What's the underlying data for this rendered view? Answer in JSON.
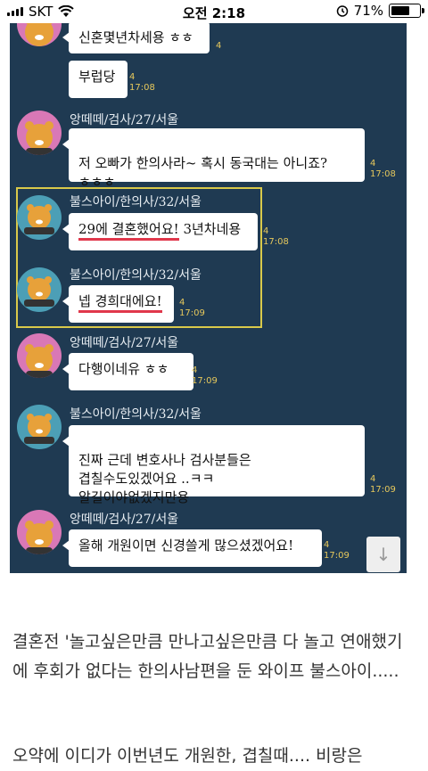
{
  "statusbar": {
    "carrier": "SKT",
    "time": "오전 2:18",
    "battery_text": "71%",
    "battery_level_pct": 71,
    "icons": [
      "signal-icon",
      "wifi-icon",
      "alarm-icon",
      "battery-icon"
    ]
  },
  "chat": {
    "background": "#1f3a52",
    "messages": [
      {
        "text": "신혼몇년차세용 ㅎㅎ",
        "unread": "4",
        "time": ""
      },
      {
        "text": "부럽당",
        "unread": "4",
        "time": "17:08"
      },
      {
        "sender": "앙떼떼/검사/27/서울",
        "text": "저 오빠가 한의사라~ 혹시 동국대는 아니죠?\nㅎㅎㅎ",
        "unread": "4",
        "time": "17:08"
      },
      {
        "sender": "불스아이/한의사/32/서울",
        "text_highlight": "29에 결혼했어요!",
        "text_rest": " 3년차네용",
        "unread": "4",
        "time": "17:08"
      },
      {
        "sender": "불스아이/한의사/32/서울",
        "text_highlight": "넵 경희대에요!",
        "unread": "4",
        "time": "17:09"
      },
      {
        "sender": "앙떼떼/검사/27/서울",
        "text": "다행이네유 ㅎㅎ",
        "unread": "4",
        "time": "17:09"
      },
      {
        "sender": "불스아이/한의사/32/서울",
        "text": "진짜 근데 변호사나 검사분들은\n겹칠수도있겠어요 ..ㅋㅋ\n알길이야없겠지만용",
        "unread": "4",
        "time": "17:09"
      },
      {
        "sender": "앙떼떼/검사/27/서울",
        "text": "올해 개원이면 신경쓸게 많으셨겠어요!",
        "unread": "4",
        "time": "17:09"
      }
    ],
    "scroll_button": "↓"
  },
  "article": {
    "paragraph1": "결혼전 '놀고싶은만큼 만나고싶은만큼 다 놀고 연애했기에 후회가 없다는 한의사남편을 둔 와이프 불스아이.....",
    "paragraph2": "오약에 이디가 이번년도 개원한, 겹칠때.... 비랑은"
  },
  "colors": {
    "highlight_box": "#d9c94a",
    "underline": "#e0374b",
    "meta": "#e6c85c"
  }
}
